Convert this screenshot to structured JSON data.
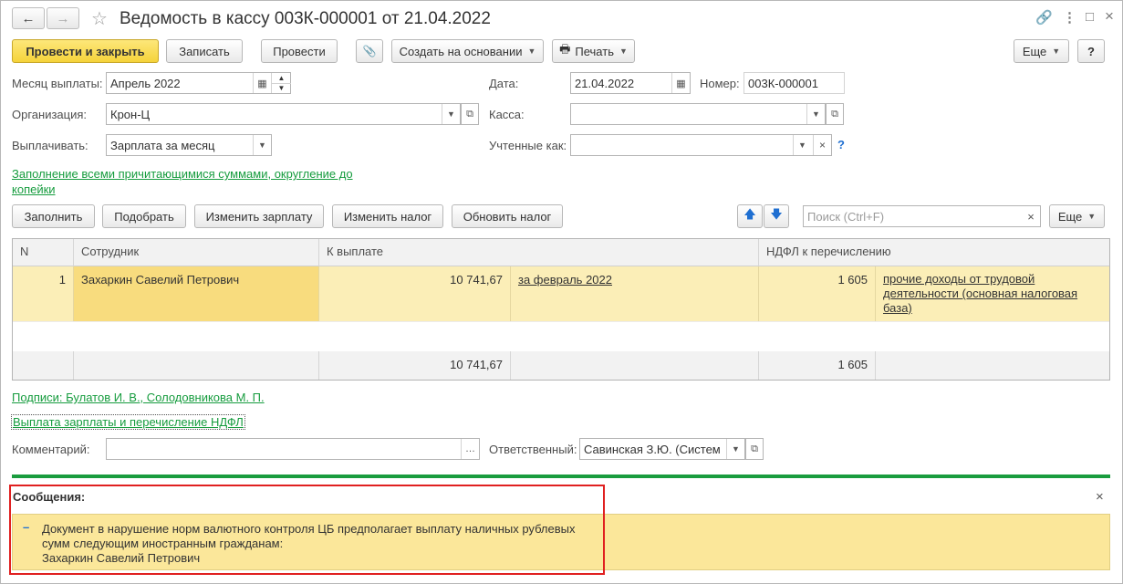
{
  "window": {
    "title": "Ведомость в кассу 003К-000001 от 21.04.2022",
    "back_icon": "←",
    "forward_icon": "→",
    "star_icon": "☆",
    "link_icon": "🔗",
    "menu_icon": "⋮",
    "maximize_icon": "□",
    "close_icon": "×"
  },
  "toolbar": {
    "post_close": "Провести и закрыть",
    "save": "Записать",
    "post": "Провести",
    "attach_icon": "📎",
    "create_based": "Создать на основании",
    "print_icon": "🖶",
    "print": "Печать",
    "more": "Еще",
    "help": "?"
  },
  "form": {
    "month_label": "Месяц выплаты:",
    "month_value": "Апрель 2022",
    "date_label": "Дата:",
    "date_value": "21.04.2022",
    "number_label": "Номер:",
    "number_value": "003К-000001",
    "org_label": "Организация:",
    "org_value": "Крон-Ц",
    "cash_label": "Касса:",
    "cash_value": "",
    "pay_label": "Выплачивать:",
    "pay_value": "Зарплата за месяц",
    "accounted_label": "Учтенные как:",
    "accounted_value": "",
    "help_q": "?",
    "fill_link_1": "Заполнение всеми причитающимися суммами, округление до",
    "fill_link_2": "копейки"
  },
  "table_toolbar": {
    "fill": "Заполнить",
    "pick": "Подобрать",
    "change_salary": "Изменить зарплату",
    "change_tax": "Изменить налог",
    "update_tax": "Обновить налог",
    "up_icon": "🡅",
    "down_icon": "🡇",
    "search_placeholder": "Поиск (Ctrl+F)",
    "clear_icon": "×",
    "more": "Еще"
  },
  "table": {
    "headers": [
      "N",
      "Сотрудник",
      "К выплате",
      "НДФЛ к перечислению"
    ],
    "rows": [
      {
        "n": "1",
        "employee": "Захаркин Савелий Петрович",
        "amount": "10 741,67",
        "period": "за февраль 2022",
        "ndfl": "1 605",
        "income_1": "прочие доходы от трудовой",
        "income_2": "деятельности (основная налоговая",
        "income_3": "база)"
      }
    ],
    "footer": {
      "amount": "10 741,67",
      "ndfl": "1 605"
    }
  },
  "links": {
    "signatures": "Подписи: Булатов И. В., Солодовникова М. П.",
    "payment": "Выплата зарплаты и перечисление НДФЛ"
  },
  "bottom": {
    "comment_label": "Комментарий:",
    "comment_value": "",
    "responsible_label": "Ответственный:",
    "responsible_value": "Савинская З.Ю. (Систем"
  },
  "messages": {
    "title": "Сообщения:",
    "close_icon": "×",
    "bullet": "–",
    "line_1": "Документ в нарушение норм валютного контроля ЦБ предполагает выплату наличных рублевых",
    "line_2": "сумм следующим иностранным гражданам:",
    "line_3": "Захаркин Савелий Петрович"
  },
  "colors": {
    "primary_button": "#f5d33a",
    "link": "#169c3e",
    "selected_row": "#fbeeb7",
    "divider": "#1a9c3e",
    "highlight_border": "#e02020"
  }
}
